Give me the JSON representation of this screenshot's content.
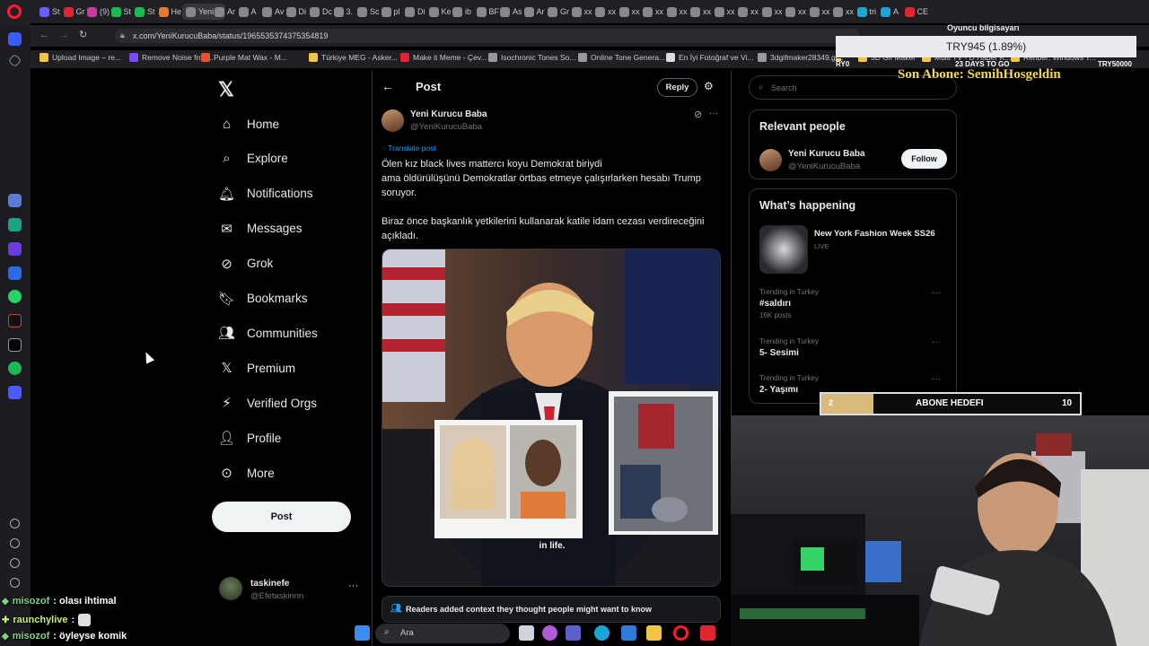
{
  "browser": {
    "tabs": [
      "St",
      "Gr",
      "(9)",
      "St",
      "St",
      "He",
      "Yeni K",
      "Ar",
      "A",
      "Av",
      "Di",
      "Dc",
      "3.",
      "Sc",
      "pl",
      "Di",
      "Ke",
      "ib",
      "BF",
      "As",
      "Ar",
      "Gr",
      "xx",
      "xx",
      "xx",
      "xx",
      "xx",
      "xx",
      "xx",
      "xx",
      "xx",
      "xx",
      "xx",
      "xx",
      "tri",
      "A",
      "CE"
    ],
    "active_tab": "Yeni K",
    "url": "x.com/YeniKurucuBaba/status/1965535374375354819",
    "bookmarks": [
      "Upload Image – re...",
      "Remove Noise from...",
      "Purple Mat Wax - M...",
      "Türkiye MEG - Asker...",
      "Make it Meme - Çev...",
      "Isochronic Tones So...",
      "Online Tone Genera...",
      "En İyi Fotoğraf ve Vi...",
      "3dgifmaker28349.gi...",
      "3D Gif Maker",
      "Multi TV - D Haber K...",
      "Rehber: Windows T..."
    ]
  },
  "nav": {
    "items": [
      {
        "label": "Home",
        "icon": "home-icon"
      },
      {
        "label": "Explore",
        "icon": "search-icon"
      },
      {
        "label": "Notifications",
        "icon": "bell-icon"
      },
      {
        "label": "Messages",
        "icon": "mail-icon"
      },
      {
        "label": "Grok",
        "icon": "grok-icon"
      },
      {
        "label": "Bookmarks",
        "icon": "bookmark-icon"
      },
      {
        "label": "Communities",
        "icon": "people-icon"
      },
      {
        "label": "Premium",
        "icon": "x-icon"
      },
      {
        "label": "Verified Orgs",
        "icon": "bolt-icon"
      },
      {
        "label": "Profile",
        "icon": "person-icon"
      },
      {
        "label": "More",
        "icon": "more-circle-icon"
      }
    ],
    "post_button": "Post",
    "account": {
      "name": "taskinefe",
      "handle": "@Efetaskinnn"
    }
  },
  "post": {
    "header": "Post",
    "reply_button": "Reply",
    "author_name": "Yeni Kurucu Baba",
    "author_handle": "@YeniKurucuBaba",
    "translate": "Translate post",
    "text_line1": "Ölen kız black lives mattercı koyu Demokrat biriydi",
    "text_line2": "ama öldürülüşünü Demokratlar örtbas etmeye çalışırlarken hesabı Trump soruyor.",
    "text_line3": "Biraz önce başkanlık yetkilerini kullanarak katile idam cezası verdireceğini açıkladı.",
    "video_caption": "in life.",
    "context_note": "Readers added context they thought people might want to know"
  },
  "right": {
    "search_placeholder": "Search",
    "relevant_title": "Relevant people",
    "relevant_name": "Yeni Kurucu Baba",
    "relevant_handle": "@YeniKurucuBaba",
    "follow_label": "Follow",
    "happening_title": "What’s happening",
    "featured": {
      "name": "New York Fashion Week SS26",
      "status": "LIVE"
    },
    "trends": [
      {
        "context": "Trending in Turkey",
        "name": "#saldırı",
        "count": "16K posts"
      },
      {
        "context": "Trending in Turkey",
        "name": "5- Sesimi",
        "count": ""
      },
      {
        "context": "Trending in Turkey",
        "name": "2- Yaşımı",
        "count": ""
      }
    ]
  },
  "overlay": {
    "donation_label": "Oyuncu bilgisayarı",
    "donation_value": "TRY945 (1.89%)",
    "donation_start": "RY0",
    "donation_days": "23 DAYS TO GO",
    "donation_goal": "TRY50000",
    "donation_progress": 0.0189,
    "last_sub": "Son Abone: SemihHosgeldin",
    "goal_title": "ABONE HEDEFI",
    "goal_current": "2",
    "goal_target": "10",
    "goal_progress": 0.2
  },
  "chat": [
    {
      "user": "misozof",
      "message": ": olası ihtimal",
      "color": "#7fd47f"
    },
    {
      "user": "raunchylive",
      "message": ":",
      "color": "#c6f06a"
    },
    {
      "user": "misozof",
      "message": ": öyleyse komik",
      "color": "#7fd47f"
    }
  ],
  "taskbar": {
    "search_label": "Ara"
  }
}
